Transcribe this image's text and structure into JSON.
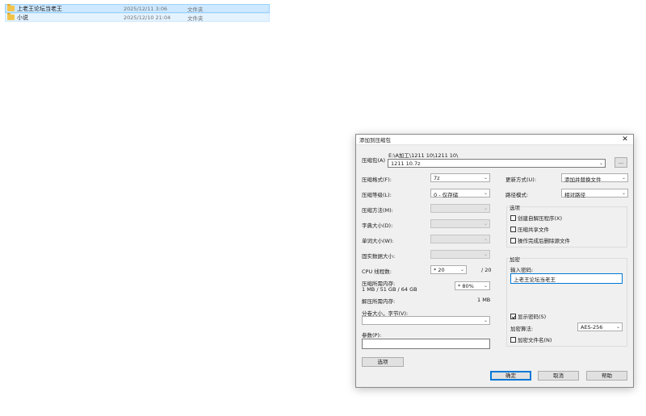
{
  "files": [
    {
      "name": "上老王论坛当老王",
      "date": "2025/12/11 3:06",
      "type": "文件夹"
    },
    {
      "name": "小说",
      "date": "2025/12/10 21:04",
      "type": "文件夹"
    }
  ],
  "dialog": {
    "title": "添加到压缩包",
    "archive_label": "压缩包(A)",
    "archive_path": "E:\\A加工\\1211 10\\1211 10\\",
    "archive_name": "1211 10.7z",
    "browse_label": "...",
    "format_label": "压缩格式(F):",
    "format_value": "7z",
    "level_label": "压缩等级(L):",
    "level_value": "0 - 仅存储",
    "method_label": "压缩方法(M):",
    "dict_label": "字典大小(D):",
    "word_label": "单词大小(W):",
    "solid_label": "固实数据大小:",
    "cpu_label": "CPU 线程数:",
    "cpu_value": "* 20",
    "cpu_max": "/ 20",
    "mem_label": "压缩所需内存:",
    "mem_detail": "1 MB / 51 GB / 64 GB",
    "mem_value": "* 80%",
    "decomp_mem_label": "解压所需内存:",
    "decomp_mem_value": "1 MB",
    "split_label": "分卷大小，字节(V):",
    "params_label": "参数(P):",
    "options_button": "选项",
    "update_label": "更新方式(U):",
    "update_value": "添加并替换文件",
    "path_mode_label": "路径模式:",
    "path_mode_value": "相对路径",
    "options_group": "选项",
    "opt_sfx": "创建自解压程序(X)",
    "opt_shared": "压缩共享文件",
    "opt_delete": "操作完成后删除源文件",
    "encrypt_group": "加密",
    "password_label": "输入密码:",
    "password_value": "上老王论坛当老王",
    "show_password": "显示密码(S)",
    "encrypt_method_label": "加密算法:",
    "encrypt_method_value": "AES-256",
    "encrypt_names": "加密文件名(N)",
    "ok_button": "确定",
    "cancel_button": "取消",
    "help_button": "帮助"
  }
}
